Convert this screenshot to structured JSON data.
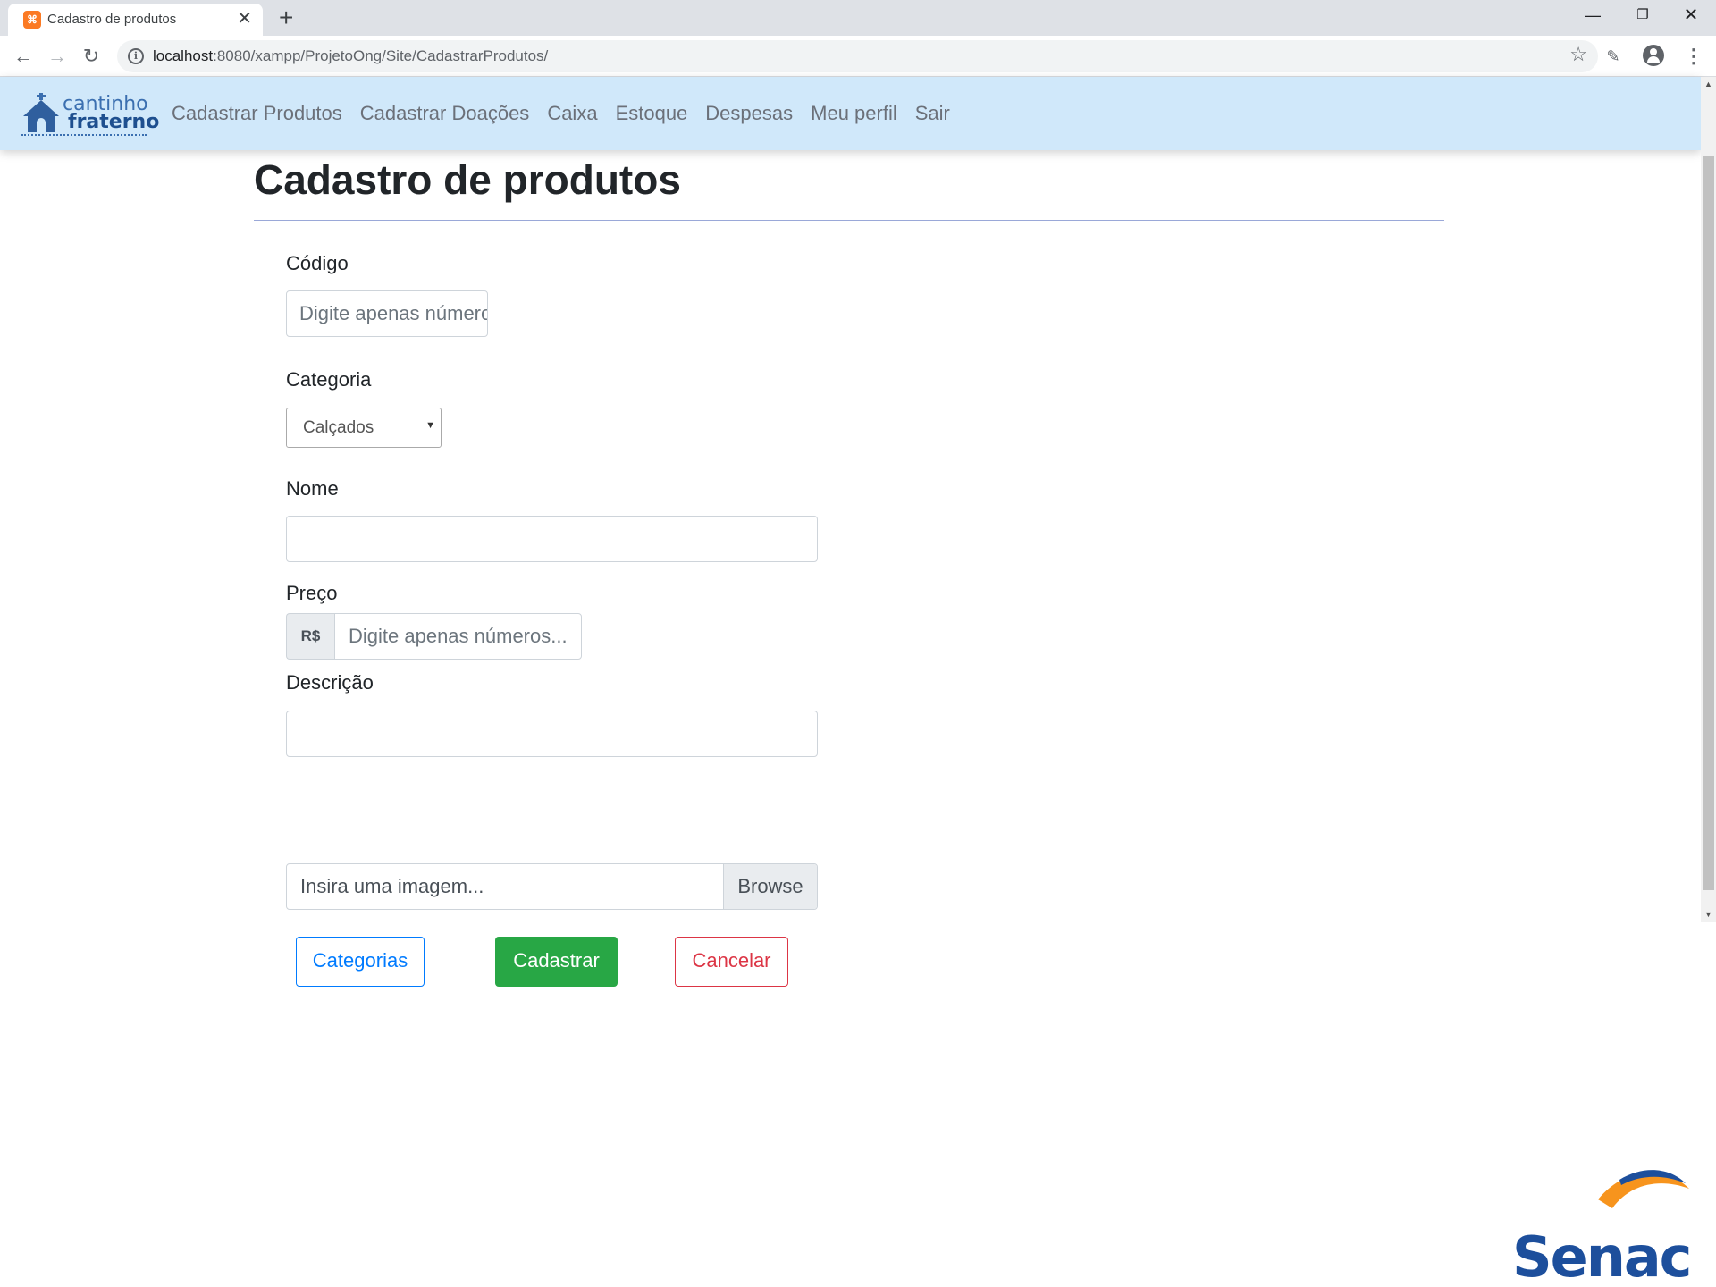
{
  "browser": {
    "tab_title": "Cadastro de produtos",
    "tab_favicon": "⌘",
    "url_host": "localhost",
    "url_rest": ":8080/xampp/ProjetoOng/Site/CadastrarProdutos/"
  },
  "site": {
    "logo_line1": "cantinho",
    "logo_line2": "fraterno",
    "nav": [
      "Cadastrar Produtos",
      "Cadastrar Doações",
      "Caixa",
      "Estoque",
      "Despesas",
      "Meu perfil",
      "Sair"
    ]
  },
  "form": {
    "title": "Cadastro de produtos",
    "codigo_label": "Código",
    "codigo_placeholder": "Digite apenas números...",
    "categoria_label": "Categoria",
    "categoria_value": "Calçados",
    "nome_label": "Nome",
    "nome_value": "",
    "preco_label": "Preço",
    "preco_prefix": "R$",
    "preco_placeholder": "Digite apenas números...",
    "descricao_label": "Descrição",
    "descricao_value": "",
    "file_placeholder": "Insira uma imagem...",
    "file_button": "Browse",
    "btn_categorias": "Categorias",
    "btn_cadastrar": "Cadastrar",
    "btn_cancelar": "Cancelar"
  },
  "watermark": {
    "brand": "Senac"
  },
  "colors": {
    "nav_bg": "#d0e8fa",
    "primary": "#007bff",
    "success": "#28a745",
    "danger": "#dc3545",
    "senac_blue": "#1d4f9c",
    "senac_orange": "#f7941d"
  }
}
